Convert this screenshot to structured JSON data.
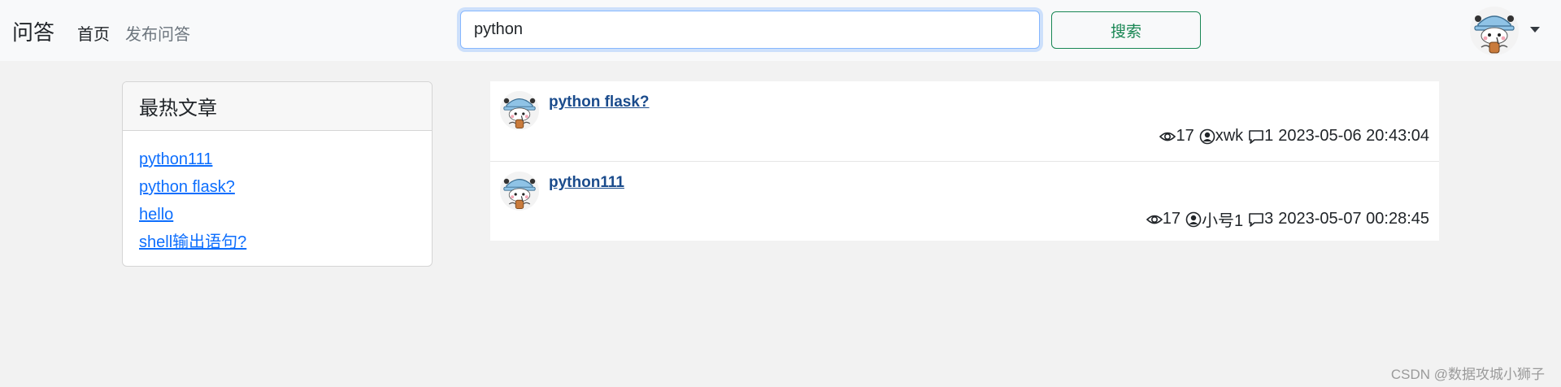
{
  "navbar": {
    "brand": "问答",
    "links": [
      "首页",
      "发布问答"
    ],
    "search": {
      "value": "python",
      "button_label": "搜索"
    }
  },
  "hot_articles": {
    "title": "最热文章",
    "items": [
      "python111",
      "python flask?",
      "hello",
      "shell输出语句?"
    ]
  },
  "questions": [
    {
      "title": "python flask?",
      "views": "17",
      "author": "xwk",
      "comments": "1",
      "time": "2023-05-06 20:43:04"
    },
    {
      "title": "python111",
      "views": "17",
      "author": "小号1",
      "comments": "3",
      "time": "2023-05-07 00:28:45"
    }
  ],
  "watermark": "CSDN @数据攻城小狮子",
  "colors": {
    "link": "#0d6efd",
    "search_button": "#198754",
    "question_title": "#1a4b8c"
  },
  "icons": [
    "eye-icon",
    "person-circle-icon",
    "chat-icon",
    "caret-down-icon"
  ]
}
